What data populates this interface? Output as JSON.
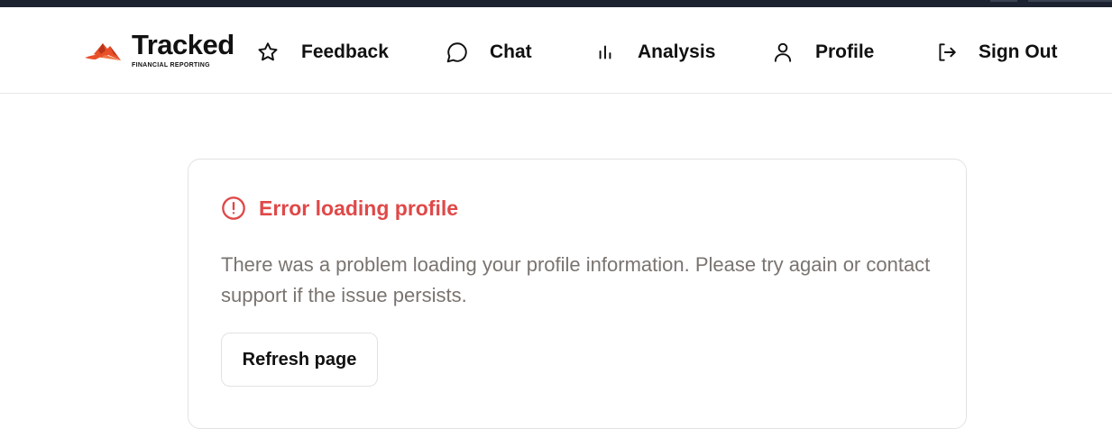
{
  "brand": {
    "name": "Tracked",
    "tagline": "FINANCIAL REPORTING",
    "accent_color": "#e8502a"
  },
  "nav": {
    "items": [
      {
        "label": "Feedback",
        "icon": "star-icon"
      },
      {
        "label": "Chat",
        "icon": "chat-bubble-icon"
      },
      {
        "label": "Analysis",
        "icon": "bar-chart-icon"
      },
      {
        "label": "Profile",
        "icon": "user-icon"
      },
      {
        "label": "Sign Out",
        "icon": "sign-out-icon"
      }
    ]
  },
  "error": {
    "title": "Error loading profile",
    "message": "There was a problem loading your profile information. Please try again or contact support if the issue persists.",
    "icon": "alert-circle-icon",
    "color": "#e04848",
    "refresh_label": "Refresh page"
  }
}
